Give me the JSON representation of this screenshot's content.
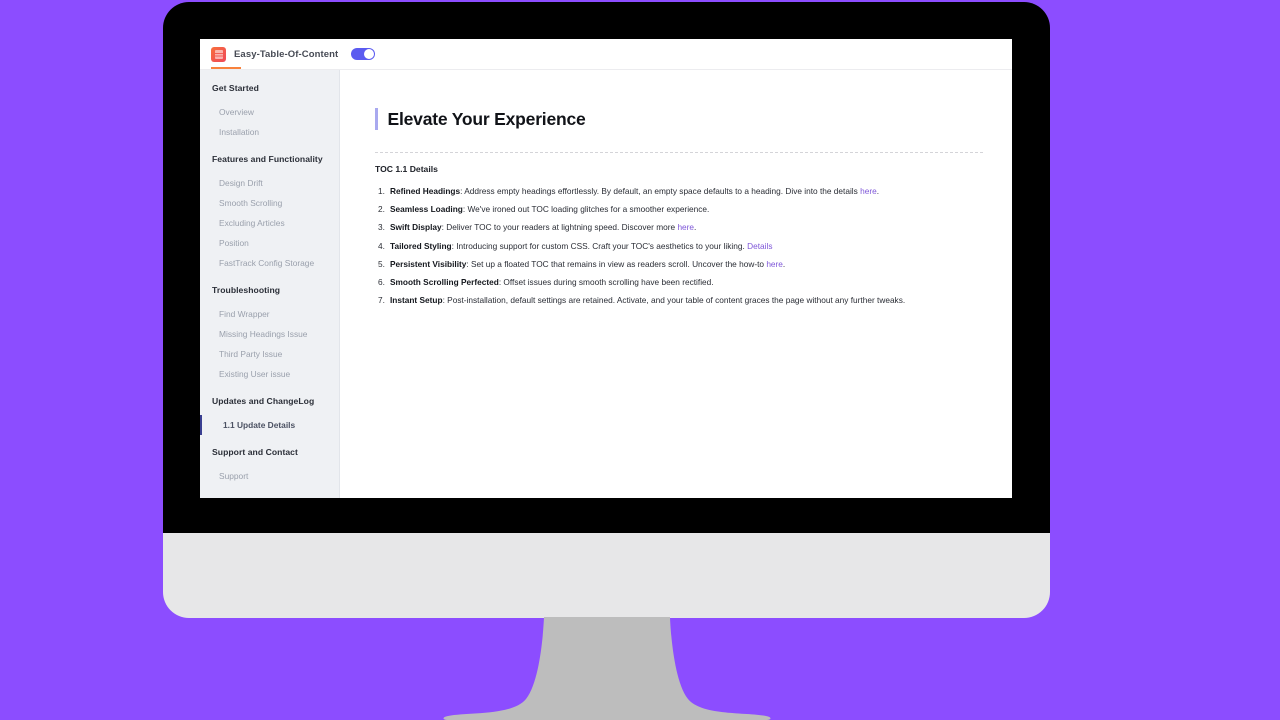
{
  "theme": {
    "background_color": "#8c4dff",
    "bezel_color": "#000000",
    "chin_color": "#e7e7e8",
    "stand_color": "#bdbdbd",
    "sidebar_color": "#eff1f4",
    "accent_link_color": "#7e56d8",
    "toggle_on_color": "#5b5bf0",
    "active_nav_bar_color": "#3a3f91",
    "title_accent_color": "#a9a9ef",
    "logo_gradient": "#f8703c"
  },
  "topbar": {
    "logo_icon": "table-of-content-logo-icon",
    "brand_title": "Easy-Table-Of-Content",
    "toggle": {
      "name": "header-theme-toggle",
      "state": "on"
    }
  },
  "sidebar": {
    "sections": [
      {
        "heading": "Get Started",
        "items": [
          {
            "label": "Overview",
            "active": false
          },
          {
            "label": "Installation",
            "active": false
          }
        ]
      },
      {
        "heading": "Features and Functionality",
        "items": [
          {
            "label": "Design Drift",
            "active": false
          },
          {
            "label": "Smooth Scrolling",
            "active": false
          },
          {
            "label": "Excluding Articles",
            "active": false
          },
          {
            "label": "Position",
            "active": false
          },
          {
            "label": "FastTrack Config Storage",
            "active": false
          }
        ]
      },
      {
        "heading": "Troubleshooting",
        "items": [
          {
            "label": "Find Wrapper",
            "active": false
          },
          {
            "label": "Missing Headings Issue",
            "active": false
          },
          {
            "label": "Third Party Issue",
            "active": false
          },
          {
            "label": "Existing User issue",
            "active": false
          }
        ]
      },
      {
        "heading": "Updates and ChangeLog",
        "items": [
          {
            "label": "1.1 Update Details",
            "active": true
          }
        ]
      },
      {
        "heading": "Support and Contact",
        "items": [
          {
            "label": "Support",
            "active": false
          }
        ]
      }
    ]
  },
  "main": {
    "page_title": "Elevate Your Experience",
    "section_label": "TOC 1.1 Details",
    "features": [
      {
        "term": "Refined Headings",
        "text": ": Address empty headings effortlessly. By default, an empty space defaults to a heading. Dive into the details ",
        "link": "here",
        "tail": "."
      },
      {
        "term": "Seamless Loading",
        "text": ": We've ironed out TOC loading glitches for a smoother experience.",
        "link": "",
        "tail": ""
      },
      {
        "term": "Swift Display",
        "text": ": Deliver TOC to your readers at lightning speed. Discover more ",
        "link": "here",
        "tail": "."
      },
      {
        "term": "Tailored Styling",
        "text": ": Introducing support for custom CSS. Craft your TOC's aesthetics to your liking. ",
        "link": "Details",
        "tail": ""
      },
      {
        "term": "Persistent Visibility",
        "text": ": Set up a floated TOC that remains in view as readers scroll. Uncover the how-to ",
        "link": "here",
        "tail": "."
      },
      {
        "term": "Smooth Scrolling Perfected",
        "text": ": Offset issues during smooth scrolling have been rectified.",
        "link": "",
        "tail": ""
      },
      {
        "term": "Instant Setup",
        "text": ": Post-installation, default settings are retained. Activate, and your table of content graces the page without any further tweaks.",
        "link": "",
        "tail": ""
      }
    ]
  }
}
